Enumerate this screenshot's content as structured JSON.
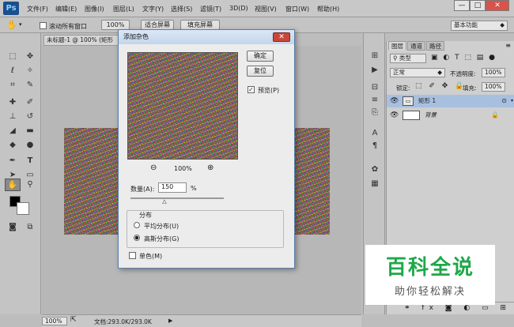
{
  "app": {
    "logo": "Ps"
  },
  "menubar": {
    "items": [
      "文件(F)",
      "编辑(E)",
      "图像(I)",
      "图层(L)",
      "文字(Y)",
      "选择(S)",
      "滤镜(T)",
      "3D(D)",
      "视图(V)",
      "窗口(W)",
      "帮助(H)"
    ],
    "window_buttons": [
      "—",
      "□",
      "✕"
    ]
  },
  "options_bar": {
    "scroll_all_label": "滚动所有窗口",
    "zoom_value": "100%",
    "fit_screen": "适合屏幕",
    "fill_screen": "填充屏幕",
    "workspace": "基本功能"
  },
  "document": {
    "tab_title": "未标题-1 @ 100% (矩形"
  },
  "statusbar": {
    "zoom": "100%",
    "doc_info": "文档:293.0K/293.0K"
  },
  "dialog": {
    "title": "添加杂色",
    "close": "✕",
    "ok": "确定",
    "reset": "复位",
    "preview_label": "预览(P)",
    "preview_checked": true,
    "zoom_percent": "100%",
    "amount_label": "数量(A):",
    "amount_value": "150",
    "amount_unit": "%",
    "amount_slider": 0.375,
    "distribution_label": "分布",
    "uniform_label": "平均分布(U)",
    "gaussian_label": "高斯分布(G)",
    "selected_distribution": "gaussian",
    "mono_label": "单色(M)",
    "mono_checked": false
  },
  "layers_panel": {
    "tabs": [
      "图层",
      "通道",
      "路径"
    ],
    "kind_filter": "类型",
    "blend_mode": "正常",
    "opacity_label": "不透明度:",
    "opacity_value": "100%",
    "lock_label": "锁定:",
    "fill_label": "填充:",
    "fill_value": "100%",
    "layers": [
      {
        "name": "矩形 1",
        "selected": true
      },
      {
        "name": "背景",
        "selected": false
      }
    ]
  },
  "watermark": {
    "title": "百科全说",
    "subtitle": "助你轻松解决"
  },
  "colors": {
    "dialog_title": "#c4d6ec",
    "close_red": "#c9473a",
    "selected_layer": "#a8c0e0",
    "watermark_green": "#1fa84a"
  }
}
